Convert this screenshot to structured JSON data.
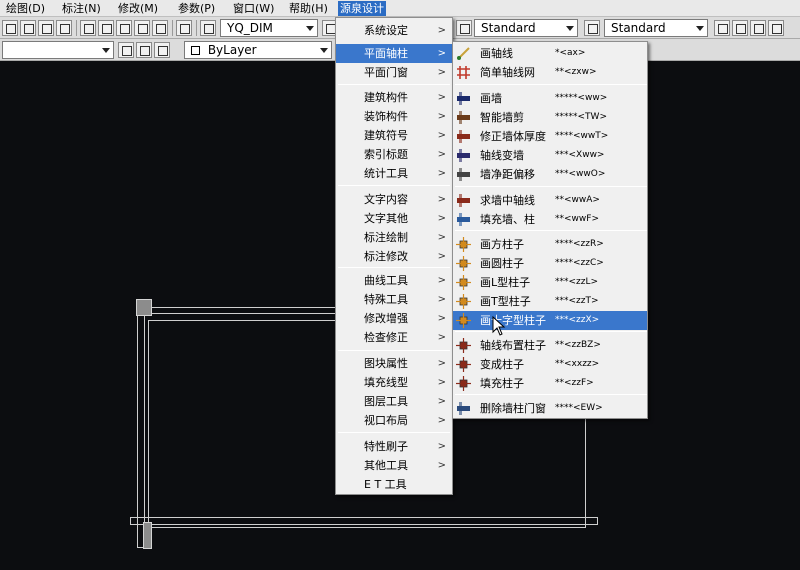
{
  "menubar": {
    "items": [
      "绘图(D)",
      "标注(N)",
      "修改(M)",
      "参数(P)",
      "窗口(W)",
      "帮助(H)",
      "源泉设计"
    ]
  },
  "toolbar": {
    "dim_style": "YQ_DIM",
    "text_style": "Standard",
    "table_style": "Standard",
    "layer": "ByLayer"
  },
  "main_menu": {
    "items": [
      {
        "label": "系统设定",
        "has_sub": true
      },
      {
        "label": "平面轴柱",
        "has_sub": true,
        "selected": true
      },
      {
        "label": "平面门窗",
        "has_sub": true
      },
      {
        "label": "建筑构件",
        "has_sub": true
      },
      {
        "label": "装饰构件",
        "has_sub": true
      },
      {
        "label": "建筑符号",
        "has_sub": true
      },
      {
        "label": "索引标题",
        "has_sub": true
      },
      {
        "label": "统计工具",
        "has_sub": true
      },
      {
        "label": "文字内容",
        "has_sub": true
      },
      {
        "label": "文字其他",
        "has_sub": true
      },
      {
        "label": "标注绘制",
        "has_sub": true
      },
      {
        "label": "标注修改",
        "has_sub": true
      },
      {
        "label": "曲线工具",
        "has_sub": true
      },
      {
        "label": "特殊工具",
        "has_sub": true
      },
      {
        "label": "修改增强",
        "has_sub": true
      },
      {
        "label": "检查修正",
        "has_sub": true
      },
      {
        "label": "图块属性",
        "has_sub": true
      },
      {
        "label": "填充线型",
        "has_sub": true
      },
      {
        "label": "图层工具",
        "has_sub": true
      },
      {
        "label": "视口布局",
        "has_sub": true
      },
      {
        "label": "特性刷子",
        "has_sub": true
      },
      {
        "label": "其他工具",
        "has_sub": true
      },
      {
        "label": "E T 工具",
        "has_sub": false
      }
    ],
    "sub_arrow": ">"
  },
  "sub_menu": {
    "items": [
      {
        "label": "画轴线",
        "shortcut": "*<ax>",
        "icon": "draw-axis-icon",
        "color": "#c9a23a"
      },
      {
        "label": "简单轴线网",
        "shortcut": "**<zxw>",
        "icon": "axis-grid-icon",
        "color": "#c0392b"
      },
      {
        "label": "画墙",
        "shortcut": "*****<ww>",
        "icon": "wall-icon",
        "color": "#1a2a6c"
      },
      {
        "label": "智能墙剪",
        "shortcut": "*****<TW>",
        "icon": "wall-trim-icon",
        "color": "#6b3b1a"
      },
      {
        "label": "修正墙体厚度",
        "shortcut": "****<wwT>",
        "icon": "wall-thickness-icon",
        "color": "#8a2a1a"
      },
      {
        "label": "轴线变墙",
        "shortcut": "***<Xww>",
        "icon": "axis-to-wall-icon",
        "color": "#2a2a6c"
      },
      {
        "label": "墙净距偏移",
        "shortcut": "***<wwO>",
        "icon": "wall-offset-icon",
        "color": "#444444"
      },
      {
        "label": "求墙中轴线",
        "shortcut": "**<wwA>",
        "icon": "wall-center-icon",
        "color": "#8a2a1a"
      },
      {
        "label": "填充墙、柱",
        "shortcut": "**<wwF>",
        "icon": "fill-wall-icon",
        "color": "#2a5a9c"
      },
      {
        "label": "画方柱子",
        "shortcut": "****<zzR>",
        "icon": "square-column-icon",
        "color": "#d28a1e"
      },
      {
        "label": "画圆柱子",
        "shortcut": "****<zzC>",
        "icon": "round-column-icon",
        "color": "#d28a1e"
      },
      {
        "label": "画L型柱子",
        "shortcut": "***<zzL>",
        "icon": "l-column-icon",
        "color": "#d28a1e"
      },
      {
        "label": "画T型柱子",
        "shortcut": "***<zzT>",
        "icon": "t-column-icon",
        "color": "#d28a1e"
      },
      {
        "label": "画十字型柱子",
        "shortcut": "***<zzX>",
        "icon": "cross-column-icon",
        "color": "#d28a1e",
        "selected": true
      },
      {
        "label": "轴线布置柱子",
        "shortcut": "**<zzBZ>",
        "icon": "axis-column-icon",
        "color": "#8a2a1a"
      },
      {
        "label": "变成柱子",
        "shortcut": "**<xxzz>",
        "icon": "to-column-icon",
        "color": "#8a2a1a"
      },
      {
        "label": "填充柱子",
        "shortcut": "**<zzF>",
        "icon": "fill-column-icon",
        "color": "#8a2a1a"
      },
      {
        "label": "删除墙柱门窗",
        "shortcut": "****<EW>",
        "icon": "delete-wall-icon",
        "color": "#2a4a7c"
      }
    ]
  }
}
